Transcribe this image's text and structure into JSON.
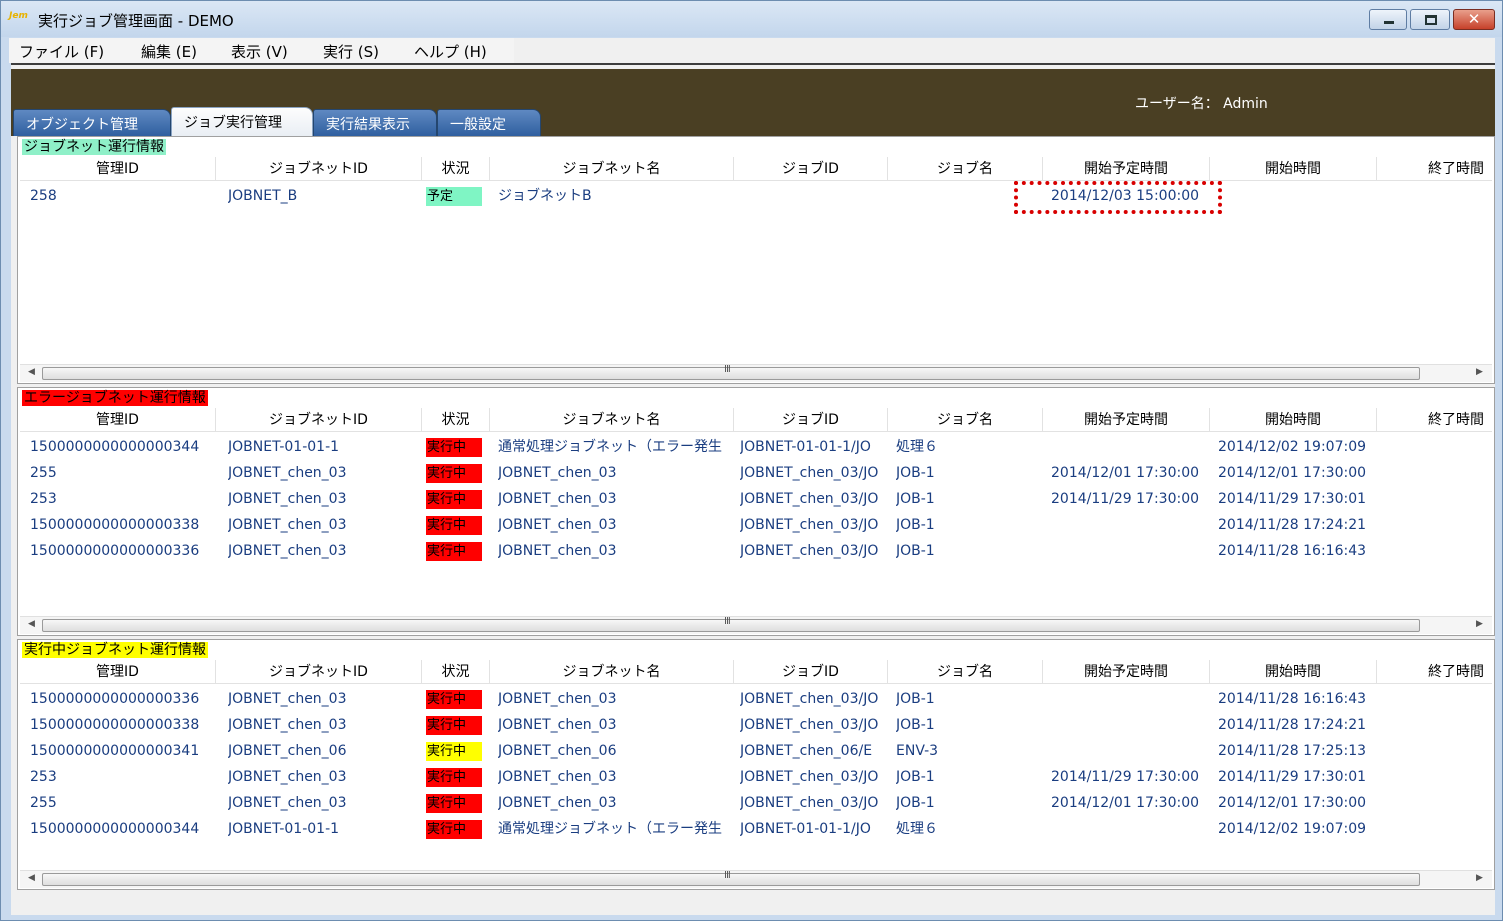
{
  "window": {
    "logo_text": "Jem",
    "title": "実行ジョブ管理画面 - DEMO"
  },
  "menu": [
    "ファイル (F)",
    "編集 (E)",
    "表示 (V)",
    "実行 (S)",
    "ヘルプ (H)"
  ],
  "header": {
    "user_label": "ユーザー名： Admin"
  },
  "tabs": [
    {
      "label": "オブジェクト管理",
      "active": false
    },
    {
      "label": "ジョブ実行管理",
      "active": true
    },
    {
      "label": "実行結果表示",
      "active": false
    },
    {
      "label": "一般設定",
      "active": false
    }
  ],
  "columns": [
    "管理ID",
    "ジョブネットID",
    "状況",
    "ジョブネット名",
    "ジョブID",
    "ジョブ名",
    "開始予定時間",
    "開始時間",
    "終了時間"
  ],
  "scroll_grip": "III",
  "panels": [
    {
      "title": "ジョブネット運行情報",
      "title_bg": "#8ff0c8",
      "rows": [
        {
          "id": "258",
          "jobnet_id": "JOBNET_B",
          "status": "予定",
          "status_color": "#7ff5c4",
          "jobnet_name": "ジョブネットB",
          "job_id": "",
          "job_name": "",
          "scheduled": "2014/12/03 15:00:00",
          "start": "",
          "end": ""
        }
      ]
    },
    {
      "title": "エラージョブネット運行情報",
      "title_bg": "#ff0000",
      "rows": [
        {
          "id": "1500000000000000344",
          "jobnet_id": "JOBNET-01-01-1",
          "status": "実行中",
          "status_color": "#ff0000",
          "jobnet_name": "通常処理ジョブネット（エラー発生",
          "job_id": "JOBNET-01-01-1/JO",
          "job_name": "処理６",
          "scheduled": "",
          "start": "2014/12/02 19:07:09",
          "end": ""
        },
        {
          "id": "255",
          "jobnet_id": "JOBNET_chen_03",
          "status": "実行中",
          "status_color": "#ff0000",
          "jobnet_name": "JOBNET_chen_03",
          "job_id": "JOBNET_chen_03/JO",
          "job_name": "JOB-1",
          "scheduled": "2014/12/01 17:30:00",
          "start": "2014/12/01 17:30:00",
          "end": ""
        },
        {
          "id": "253",
          "jobnet_id": "JOBNET_chen_03",
          "status": "実行中",
          "status_color": "#ff0000",
          "jobnet_name": "JOBNET_chen_03",
          "job_id": "JOBNET_chen_03/JO",
          "job_name": "JOB-1",
          "scheduled": "2014/11/29 17:30:00",
          "start": "2014/11/29 17:30:01",
          "end": ""
        },
        {
          "id": "1500000000000000338",
          "jobnet_id": "JOBNET_chen_03",
          "status": "実行中",
          "status_color": "#ff0000",
          "jobnet_name": "JOBNET_chen_03",
          "job_id": "JOBNET_chen_03/JO",
          "job_name": "JOB-1",
          "scheduled": "",
          "start": "2014/11/28 17:24:21",
          "end": ""
        },
        {
          "id": "1500000000000000336",
          "jobnet_id": "JOBNET_chen_03",
          "status": "実行中",
          "status_color": "#ff0000",
          "jobnet_name": "JOBNET_chen_03",
          "job_id": "JOBNET_chen_03/JO",
          "job_name": "JOB-1",
          "scheduled": "",
          "start": "2014/11/28 16:16:43",
          "end": ""
        }
      ]
    },
    {
      "title": "実行中ジョブネット運行情報",
      "title_bg": "#ffff00",
      "rows": [
        {
          "id": "1500000000000000336",
          "jobnet_id": "JOBNET_chen_03",
          "status": "実行中",
          "status_color": "#ff0000",
          "jobnet_name": "JOBNET_chen_03",
          "job_id": "JOBNET_chen_03/JO",
          "job_name": "JOB-1",
          "scheduled": "",
          "start": "2014/11/28 16:16:43",
          "end": ""
        },
        {
          "id": "1500000000000000338",
          "jobnet_id": "JOBNET_chen_03",
          "status": "実行中",
          "status_color": "#ff0000",
          "jobnet_name": "JOBNET_chen_03",
          "job_id": "JOBNET_chen_03/JO",
          "job_name": "JOB-1",
          "scheduled": "",
          "start": "2014/11/28 17:24:21",
          "end": ""
        },
        {
          "id": "1500000000000000341",
          "jobnet_id": "JOBNET_chen_06",
          "status": "実行中",
          "status_color": "#ffff00",
          "jobnet_name": "JOBNET_chen_06",
          "job_id": "JOBNET_chen_06/E",
          "job_name": "ENV-3",
          "scheduled": "",
          "start": "2014/11/28 17:25:13",
          "end": ""
        },
        {
          "id": "253",
          "jobnet_id": "JOBNET_chen_03",
          "status": "実行中",
          "status_color": "#ff0000",
          "jobnet_name": "JOBNET_chen_03",
          "job_id": "JOBNET_chen_03/JO",
          "job_name": "JOB-1",
          "scheduled": "2014/11/29 17:30:00",
          "start": "2014/11/29 17:30:01",
          "end": ""
        },
        {
          "id": "255",
          "jobnet_id": "JOBNET_chen_03",
          "status": "実行中",
          "status_color": "#ff0000",
          "jobnet_name": "JOBNET_chen_03",
          "job_id": "JOBNET_chen_03/JO",
          "job_name": "JOB-1",
          "scheduled": "2014/12/01 17:30:00",
          "start": "2014/12/01 17:30:00",
          "end": ""
        },
        {
          "id": "1500000000000000344",
          "jobnet_id": "JOBNET-01-01-1",
          "status": "実行中",
          "status_color": "#ff0000",
          "jobnet_name": "通常処理ジョブネット（エラー発生",
          "job_id": "JOBNET-01-01-1/JO",
          "job_name": "処理６",
          "scheduled": "",
          "start": "2014/12/02 19:07:09",
          "end": ""
        }
      ]
    }
  ]
}
